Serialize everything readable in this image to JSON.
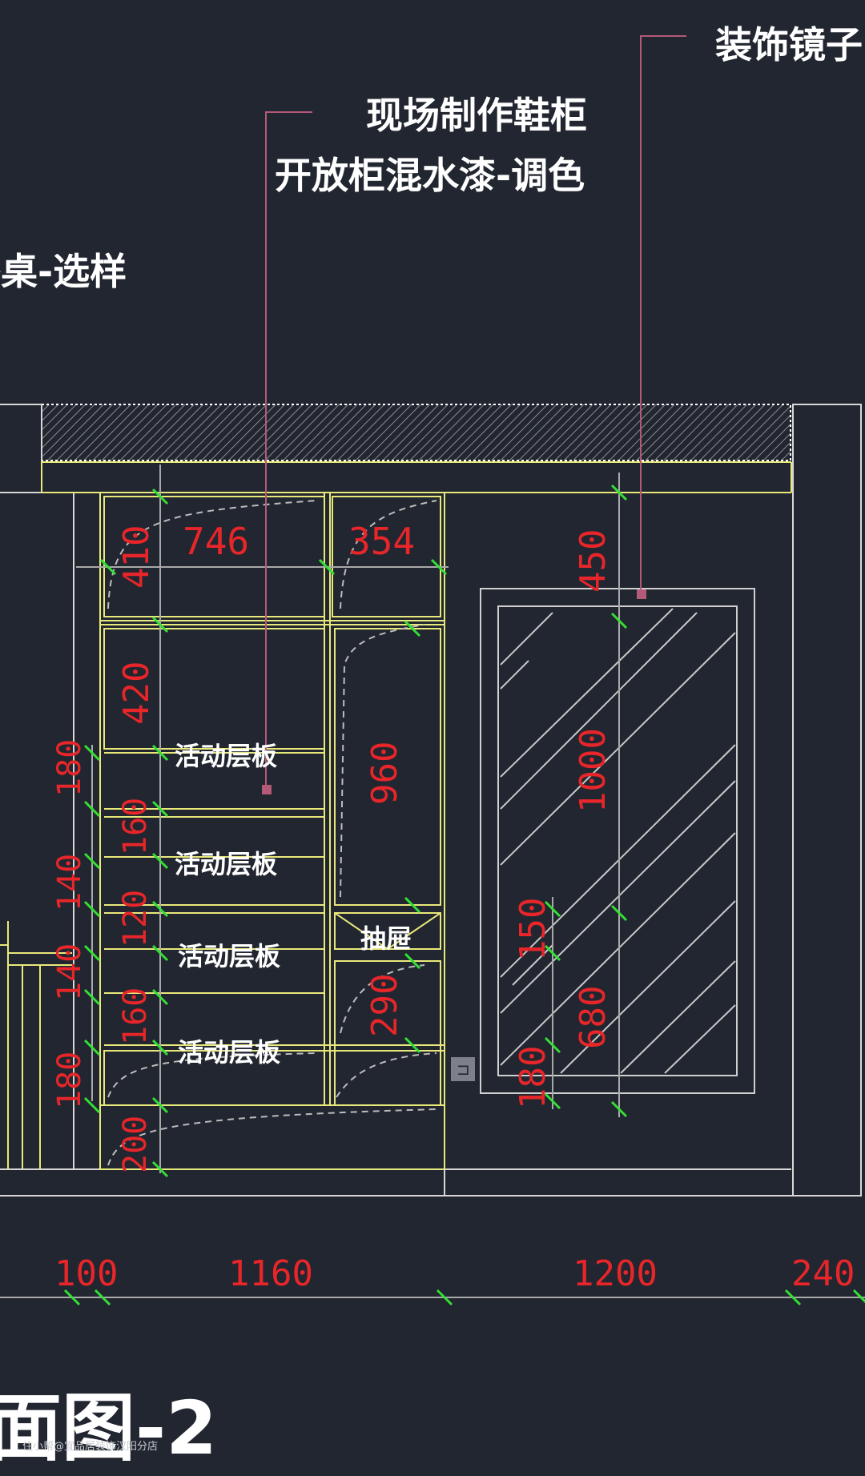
{
  "callouts": {
    "mirror": "装饰镜子",
    "cabinet_line1": "现场制作鞋柜",
    "cabinet_line2": "开放柜混水漆-调色",
    "desk": "餐桌-选样"
  },
  "dimensions": {
    "top_left": "746",
    "top_right": "354",
    "h410": "410",
    "h420": "420",
    "h960": "960",
    "h450": "450",
    "h1000": "1000",
    "h150": "150",
    "h680": "680",
    "h180_mirror": "180",
    "h290": "290",
    "left_col": [
      "180",
      "160",
      "140",
      "120",
      "140",
      "160",
      "180",
      "200"
    ],
    "bottom": [
      "100",
      "1160",
      "1200",
      "240"
    ]
  },
  "shelf_labels": [
    "活动层板",
    "活动层板",
    "活动层板",
    "活动层板"
  ],
  "drawer_label": "抽屉",
  "title": "面图-2",
  "watermark": "住小帮@宜品居装饰汉阳分店",
  "colors": {
    "background": "#212630",
    "cabinet": "#e9e97a",
    "dimension_text": "#e8262a",
    "dimension_tick": "#33e033",
    "leader": "#b45a78",
    "outline": "#d8d8d8"
  }
}
